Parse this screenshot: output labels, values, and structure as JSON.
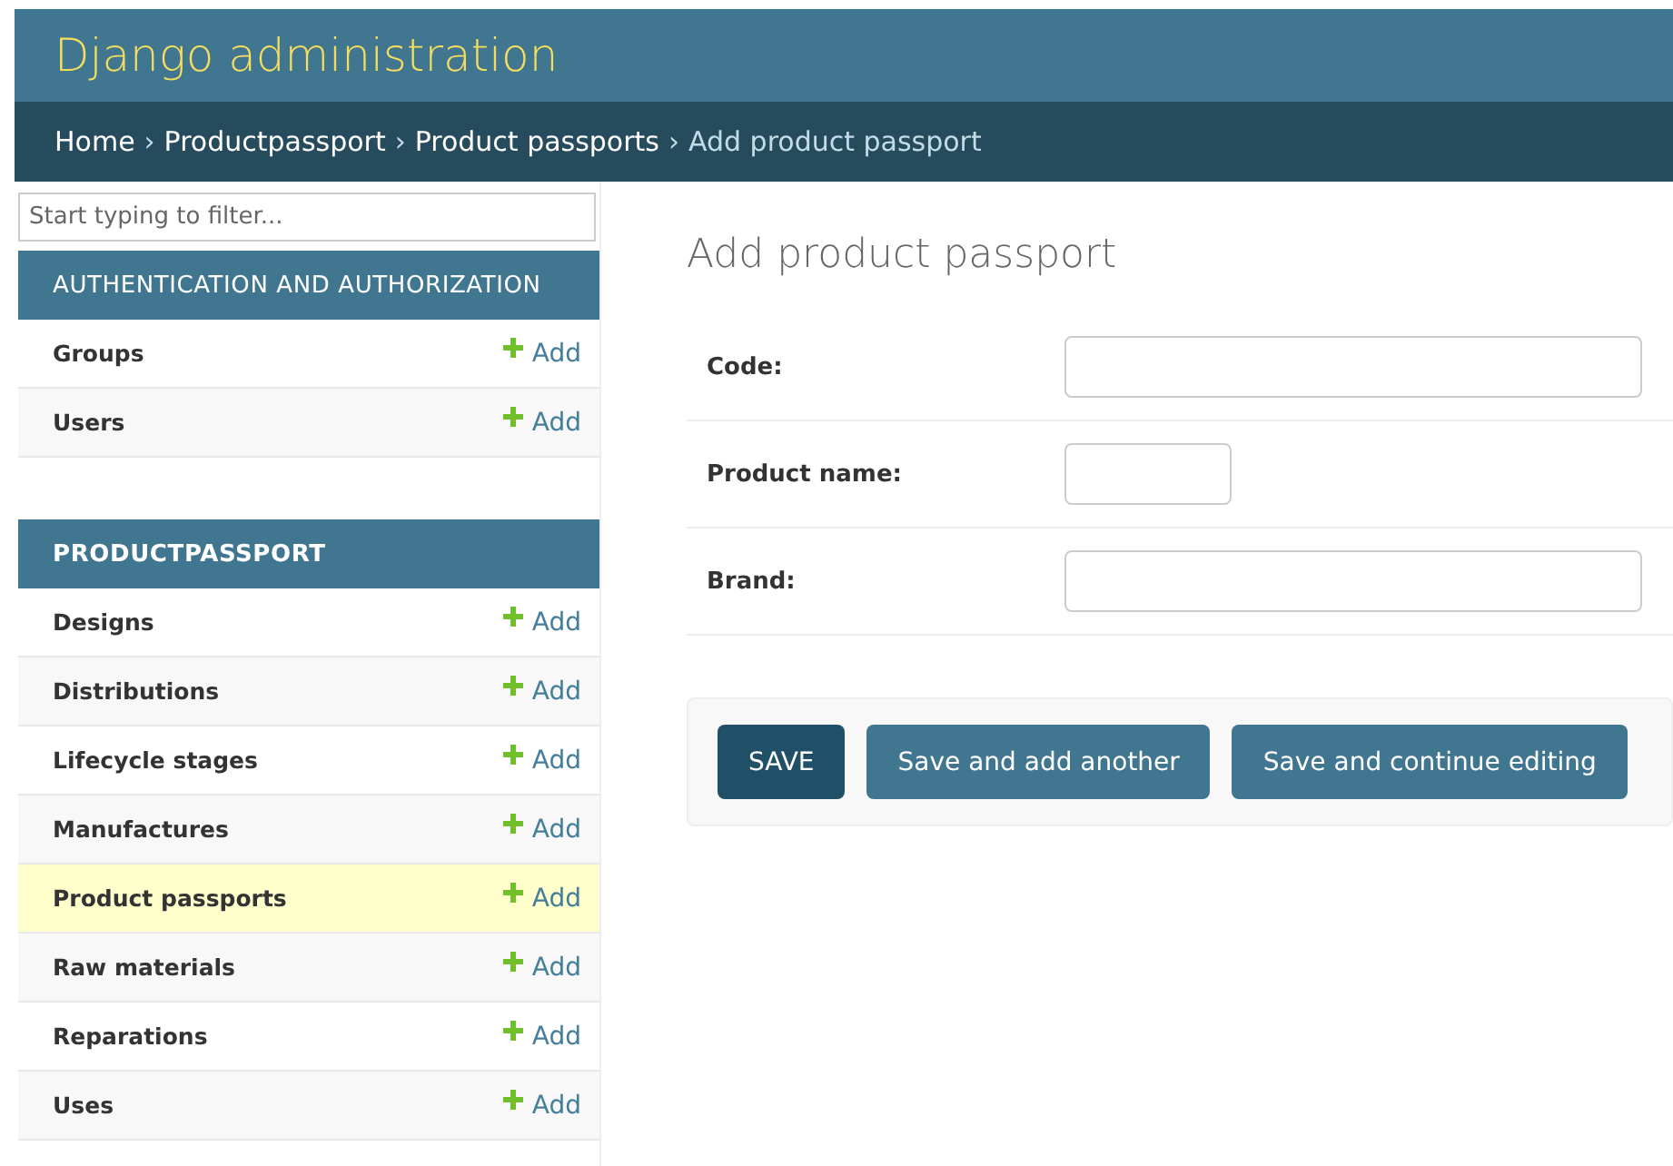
{
  "header": {
    "title": "Django administration"
  },
  "breadcrumbs": [
    {
      "label": "Home",
      "current": false
    },
    {
      "separator": "›",
      "label": "Productpassport",
      "current": false
    },
    {
      "separator": "›",
      "label": "Product passports",
      "current": false
    },
    {
      "separator": "›",
      "label": "Add product passport",
      "current": true
    }
  ],
  "sidebar": {
    "filter": {
      "placeholder": "Start typing to filter..."
    },
    "apps": [
      {
        "title": "AUTHENTICATION AND AUTHORIZATION",
        "bold": false,
        "models": [
          {
            "name": "Groups",
            "add": "Add",
            "selected": false
          },
          {
            "name": "Users",
            "add": "Add",
            "selected": false
          }
        ]
      },
      {
        "title": "PRODUCTPASSPORT",
        "bold": true,
        "models": [
          {
            "name": "Designs",
            "add": "Add",
            "selected": false
          },
          {
            "name": "Distributions",
            "add": "Add",
            "selected": false
          },
          {
            "name": "Lifecycle stages",
            "add": "Add",
            "selected": false
          },
          {
            "name": "Manufactures",
            "add": "Add",
            "selected": false
          },
          {
            "name": "Product passports",
            "add": "Add",
            "selected": true
          },
          {
            "name": "Raw materials",
            "add": "Add",
            "selected": false
          },
          {
            "name": "Reparations",
            "add": "Add",
            "selected": false
          },
          {
            "name": "Uses",
            "add": "Add",
            "selected": false
          }
        ]
      }
    ]
  },
  "content": {
    "title": "Add product passport",
    "fields": [
      {
        "label": "Code:",
        "kind": "wide"
      },
      {
        "label": "Product name:",
        "kind": "short"
      },
      {
        "label": "Brand:",
        "kind": "wide"
      }
    ],
    "buttons": [
      {
        "label": "SAVE",
        "kind": "default"
      },
      {
        "label": "Save and add another",
        "kind": "secondary"
      },
      {
        "label": "Save and continue editing",
        "kind": "secondary"
      }
    ]
  }
}
